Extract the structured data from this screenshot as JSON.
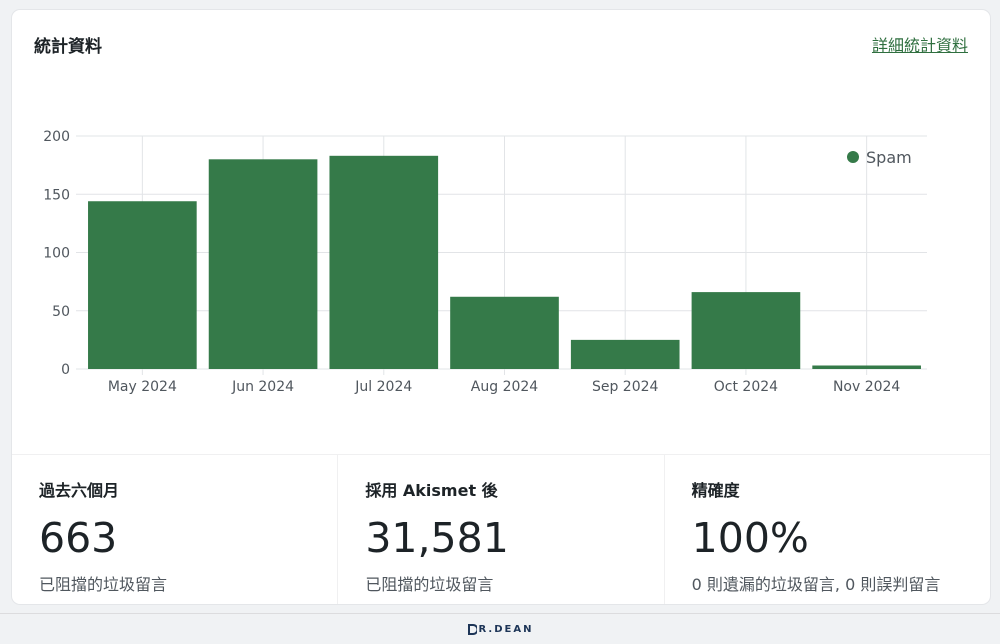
{
  "card": {
    "title": "統計資料",
    "details_link": "詳細統計資料"
  },
  "colors": {
    "accent": "#357a49",
    "link": "#2f6f3f"
  },
  "chart_data": {
    "type": "bar",
    "categories": [
      "May 2024",
      "Jun 2024",
      "Jul 2024",
      "Aug 2024",
      "Sep 2024",
      "Oct 2024",
      "Nov 2024"
    ],
    "series": [
      {
        "name": "Spam",
        "values": [
          144,
          180,
          183,
          62,
          25,
          66,
          3
        ]
      }
    ],
    "yticks": [
      0,
      50,
      100,
      150,
      200
    ],
    "ylim": [
      0,
      200
    ],
    "grid": true,
    "legend": "top-right",
    "title": "",
    "xlabel": "",
    "ylabel": ""
  },
  "stats": [
    {
      "label": "過去六個月",
      "value": "663",
      "desc": "已阻擋的垃圾留言"
    },
    {
      "label": "採用 Akismet 後",
      "value": "31,581",
      "desc": "已阻擋的垃圾留言"
    },
    {
      "label": "精確度",
      "value": "100%",
      "desc": "0 則遺漏的垃圾留言, 0 則誤判留言"
    }
  ],
  "footer": {
    "logo_text": "R.DEAN",
    "logo_icon": "dr-dean-logo-icon"
  }
}
